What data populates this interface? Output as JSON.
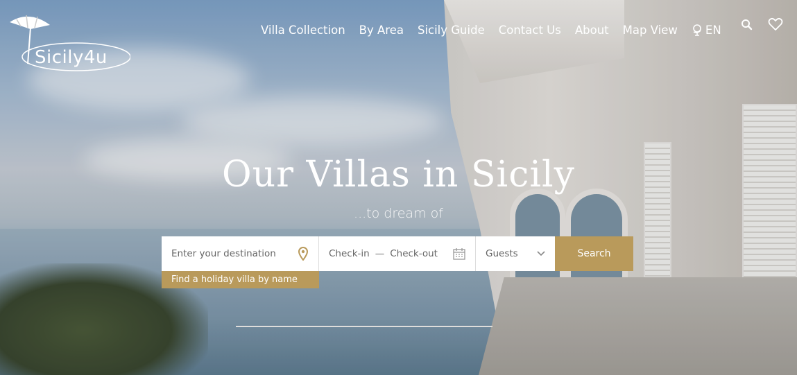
{
  "brand": {
    "logo_text": "Sicily4u"
  },
  "nav": {
    "items": [
      {
        "label": "Villa Collection"
      },
      {
        "label": "By Area"
      },
      {
        "label": "Sicily Guide"
      },
      {
        "label": "Contact Us"
      },
      {
        "label": "About"
      },
      {
        "label": "Map View"
      }
    ],
    "language": "EN",
    "icons": [
      "globe-icon",
      "search-icon",
      "heart-icon"
    ]
  },
  "hero": {
    "title": "Our Villas in Sicily",
    "subtitle": "...to dream of"
  },
  "search": {
    "destination_placeholder": "Enter your destination",
    "checkin": "Check-in",
    "dash": "—",
    "checkout": "Check-out",
    "guests": "Guests",
    "button": "Search",
    "name_link": "Find a holiday villa by name"
  },
  "colors": {
    "accent": "#b99a5b",
    "text_on_hero": "#ffffff"
  }
}
